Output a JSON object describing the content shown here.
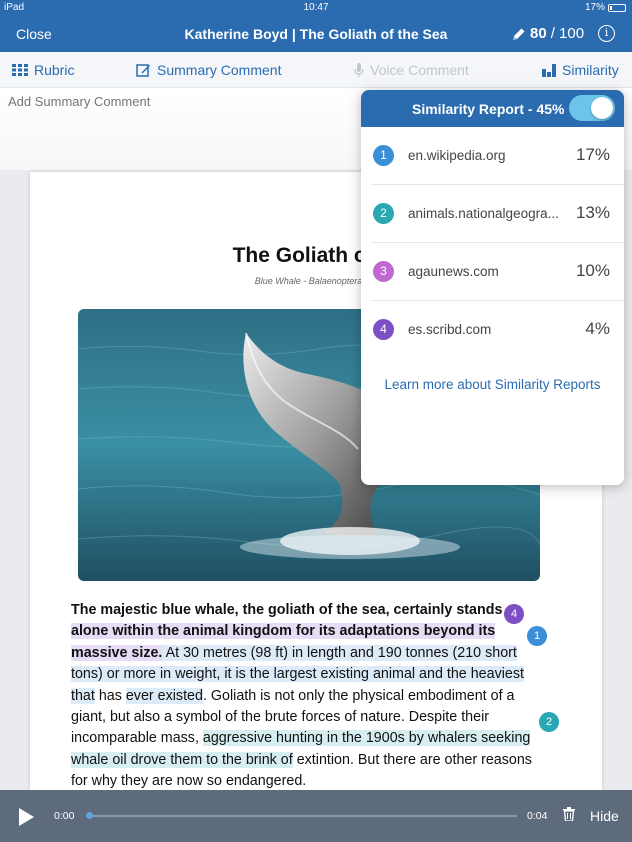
{
  "status_bar": {
    "device": "iPad",
    "time": "10:47",
    "battery": "17%",
    "battery_level": 0.17
  },
  "nav": {
    "close_label": "Close",
    "title": "Katherine Boyd  |  The Goliath of the Sea",
    "score": "80",
    "score_total": "/ 100"
  },
  "toolbar": {
    "rubric": "Rubric",
    "summary_comment": "Summary Comment",
    "voice_comment": "Voice Comment",
    "similarity": "Similarity"
  },
  "summary": {
    "placeholder": "Add Summary Comment"
  },
  "document": {
    "title": "The Goliath of th",
    "subtitle": "Blue Whale - Balaenoptera mu",
    "paragraph": {
      "p1": "The majestic blue whale, the goliath of the sea, certainly stands",
      "p2": " alone ",
      "p3": "within the animal kingdom for its adaptations beyond its massive size.",
      "p4": " At 30 metres (98 ft) in length and 190 tonnes (210 short tons) or more in weight, it is the largest existing animal and the heaviest that",
      "p5": " has ",
      "p6": "ever existed",
      "p7": ". Goliath is not only the physical embodiment of a giant, but also a symbol of the brute forces of nature. Despite their incomparable mass, ",
      "p8": "aggressive hunting in the 1900s by whalers seeking whale oil drove them to the brink of",
      "p9": " extintion. But there are other reasons for why they are now so endangered."
    }
  },
  "markers": {
    "m4": "4",
    "m1": "1",
    "m2": "2"
  },
  "similarity": {
    "header": "Similarity Report - 45%",
    "enabled": true,
    "sources": [
      {
        "num": "1",
        "source": "en.wikipedia.org",
        "percent": "17%",
        "color": "#3a8fd6"
      },
      {
        "num": "2",
        "source": "animals.nationalgeogra...",
        "percent": "13%",
        "color": "#2aa7b3"
      },
      {
        "num": "3",
        "source": "agaunews.com",
        "percent": "10%",
        "color": "#c06ad0"
      },
      {
        "num": "4",
        "source": "es.scribd.com",
        "percent": "4%",
        "color": "#7d4fc4"
      }
    ],
    "learn_more": "Learn more about Similarity Reports"
  },
  "audio": {
    "current": "0:00",
    "duration": "0:04",
    "hide_label": "Hide",
    "progress": 0
  }
}
